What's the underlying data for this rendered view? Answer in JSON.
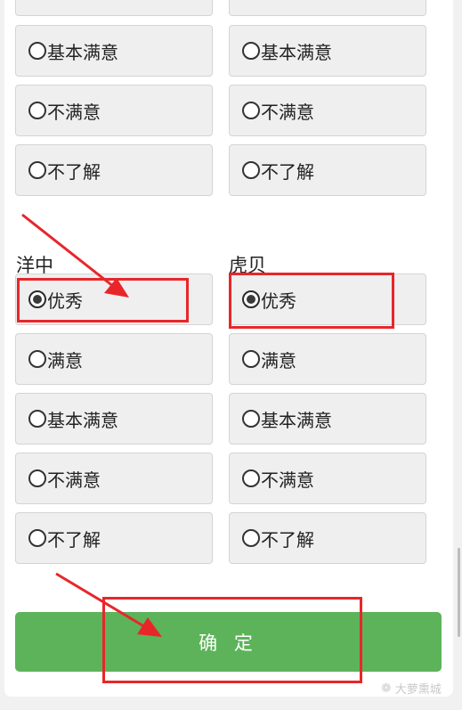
{
  "left_group": {
    "label": "洋中",
    "top_options": [
      {
        "label": "",
        "checked": false
      },
      {
        "label": "基本满意",
        "checked": false
      },
      {
        "label": "不满意",
        "checked": false
      },
      {
        "label": "不了解",
        "checked": false
      }
    ],
    "options": [
      {
        "label": "优秀",
        "checked": true
      },
      {
        "label": "满意",
        "checked": false
      },
      {
        "label": "基本满意",
        "checked": false
      },
      {
        "label": "不满意",
        "checked": false
      },
      {
        "label": "不了解",
        "checked": false
      }
    ]
  },
  "right_group": {
    "label": "虎贝",
    "top_options": [
      {
        "label": "",
        "checked": false
      },
      {
        "label": "基本满意",
        "checked": false
      },
      {
        "label": "不满意",
        "checked": false
      },
      {
        "label": "不了解",
        "checked": false
      }
    ],
    "options": [
      {
        "label": "优秀",
        "checked": true
      },
      {
        "label": "满意",
        "checked": false
      },
      {
        "label": "基本满意",
        "checked": false
      },
      {
        "label": "不满意",
        "checked": false
      },
      {
        "label": "不了解",
        "checked": false
      }
    ]
  },
  "confirm_label": "确 定",
  "watermark": "大萝熏城",
  "colors": {
    "confirm_button": "#5db35a",
    "annotation_red": "#e8262a",
    "option_bg": "#efefef"
  }
}
